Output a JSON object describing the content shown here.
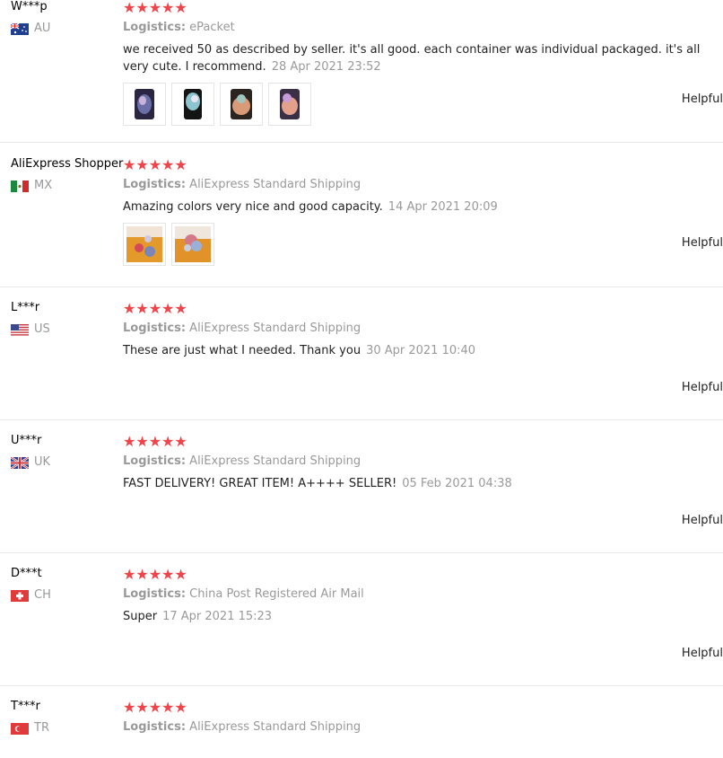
{
  "reviews": [
    {
      "user": "W***p",
      "country": "AU",
      "stars": "★★★★★",
      "logistics_label": "Logistics:",
      "logistics": "ePacket",
      "feedback": "we received 50 as described by seller. it's all good. each container was individual packaged. it's all very cute. I recommend.",
      "date": "28 Apr 2021 23:52",
      "helpful": "Helpful"
    },
    {
      "user": "AliExpress Shopper",
      "country": "MX",
      "stars": "★★★★★",
      "logistics_label": "Logistics:",
      "logistics": "AliExpress Standard Shipping",
      "feedback": "Amazing colors very nice and good capacity.",
      "date": "14 Apr 2021 20:09",
      "helpful": "Helpful"
    },
    {
      "user": "L***r",
      "country": "US",
      "stars": "★★★★★",
      "logistics_label": "Logistics:",
      "logistics": "AliExpress Standard Shipping",
      "feedback": "These are just what I needed. Thank you",
      "date": "30 Apr 2021 10:40",
      "helpful": "Helpful"
    },
    {
      "user": "U***r",
      "country": "UK",
      "stars": "★★★★★",
      "logistics_label": "Logistics:",
      "logistics": "AliExpress Standard Shipping",
      "feedback": "FAST DELIVERY! GREAT ITEM! A++++ SELLER!",
      "date": "05 Feb 2021 04:38",
      "helpful": "Helpful"
    },
    {
      "user": "D***t",
      "country": "CH",
      "stars": "★★★★★",
      "logistics_label": "Logistics:",
      "logistics": "China Post Registered Air Mail",
      "feedback": "Super",
      "date": "17 Apr 2021 15:23",
      "helpful": "Helpful"
    },
    {
      "user": "T***r",
      "country": "TR",
      "stars": "★★★★★",
      "logistics_label": "Logistics:",
      "logistics": "AliExpress Standard Shipping"
    }
  ],
  "colors": {
    "star": "#f0434a",
    "muted": "#999999",
    "divider": "#e8e8e8"
  }
}
